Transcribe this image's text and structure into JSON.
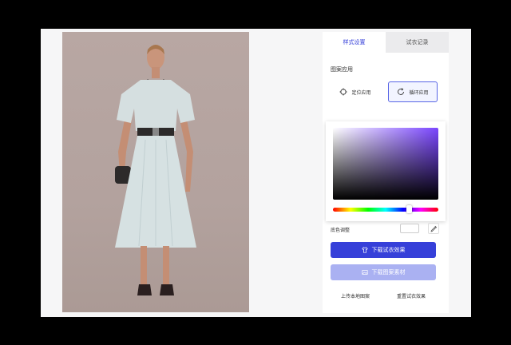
{
  "tabs": [
    {
      "label": "样式设置",
      "active": true
    },
    {
      "label": "试衣记录",
      "active": false
    }
  ],
  "pattern": {
    "title": "图案应用",
    "position_label": "定位应用",
    "loop_label": "循环应用"
  },
  "color": {
    "base_label": "底色调整",
    "picker_hue": "#7a45ff",
    "base_value": "#ffffff"
  },
  "actions": {
    "download_effect": "下载试衣效果",
    "download_material": "下载图案素材",
    "upload_local": "上传本地图案",
    "reset": "重置试衣效果"
  },
  "colors": {
    "accent": "#3640d9",
    "accent_disabled": "#aab1f2"
  }
}
